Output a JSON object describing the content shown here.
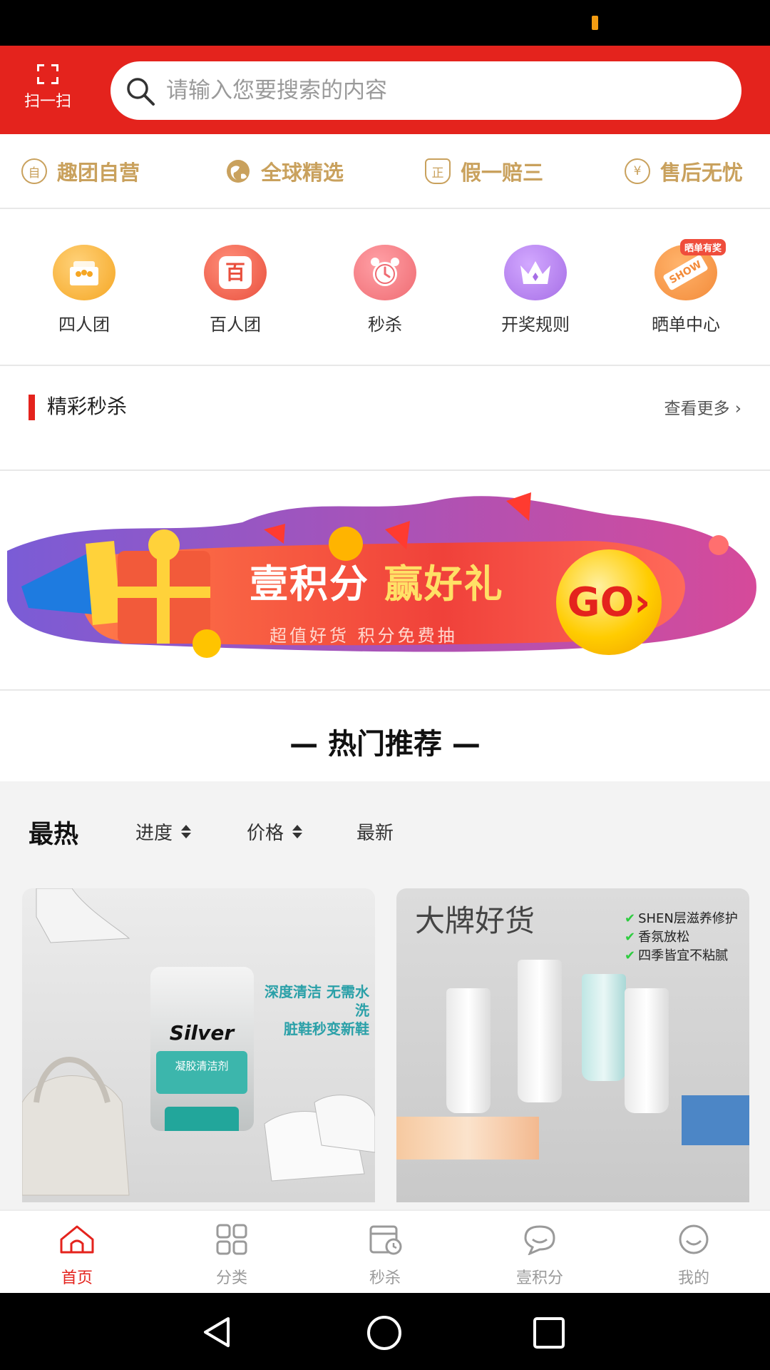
{
  "header": {
    "scan_label": "扫一扫",
    "search_placeholder": "请输入您要搜索的内容"
  },
  "guarantees": [
    {
      "icon": "self-operated-icon",
      "glyph": "自",
      "label": "趣团自营"
    },
    {
      "icon": "globe-icon",
      "glyph": "",
      "label": "全球精选"
    },
    {
      "icon": "genuine-icon",
      "glyph": "正",
      "label": "假一赔三"
    },
    {
      "icon": "yen-icon",
      "glyph": "¥",
      "label": "售后无忧"
    }
  ],
  "quick_menu": [
    {
      "label": "四人团",
      "icon": "group-four-icon",
      "color": "#f5a623",
      "glyph": "👥"
    },
    {
      "label": "百人团",
      "icon": "group-hundred-icon",
      "color": "#e94f3d",
      "glyph": "百"
    },
    {
      "label": "秒杀",
      "icon": "alarm-clock-icon",
      "color": "#ef6b72",
      "glyph": "⏰"
    },
    {
      "label": "开奖规则",
      "icon": "crown-icon",
      "color": "#a66ee6",
      "glyph": "♛"
    },
    {
      "label": "晒单中心",
      "icon": "show-tag-icon",
      "color": "#f38b3a",
      "glyph": "SHOW",
      "badge": "晒单有奖"
    }
  ],
  "flash_sale": {
    "title": "精彩秒杀",
    "more": "查看更多 ›"
  },
  "banner": {
    "title_a": "壹积分",
    "title_b": "赢好礼",
    "subtitle": "超值好货  积分免费抽",
    "go": "GO›"
  },
  "hot": {
    "title": "— 热门推荐 —"
  },
  "sort": {
    "hot": "最热",
    "progress": "进度",
    "price": "价格",
    "newest": "最新"
  },
  "products": [
    {
      "brand": "Silver",
      "band_text": "凝胶清洁剂",
      "promo": "深度清洁 无需水洗\n脏鞋秒变新鞋"
    },
    {
      "logo": "大牌好货",
      "features": [
        "SHEN层滋养修护",
        "香氛放松",
        "四季皆宜不粘腻"
      ]
    }
  ],
  "nav": [
    {
      "label": "首页",
      "icon": "home-icon",
      "active": true
    },
    {
      "label": "分类",
      "icon": "category-grid-icon",
      "active": false
    },
    {
      "label": "秒杀",
      "icon": "flash-calendar-icon",
      "active": false
    },
    {
      "label": "壹积分",
      "icon": "chat-bubble-icon",
      "active": false
    },
    {
      "label": "我的",
      "icon": "smiley-icon",
      "active": false
    }
  ],
  "colors": {
    "brand_red": "#e4231d",
    "gold": "#c9a15d",
    "nav_inactive": "#9a9a9a"
  }
}
